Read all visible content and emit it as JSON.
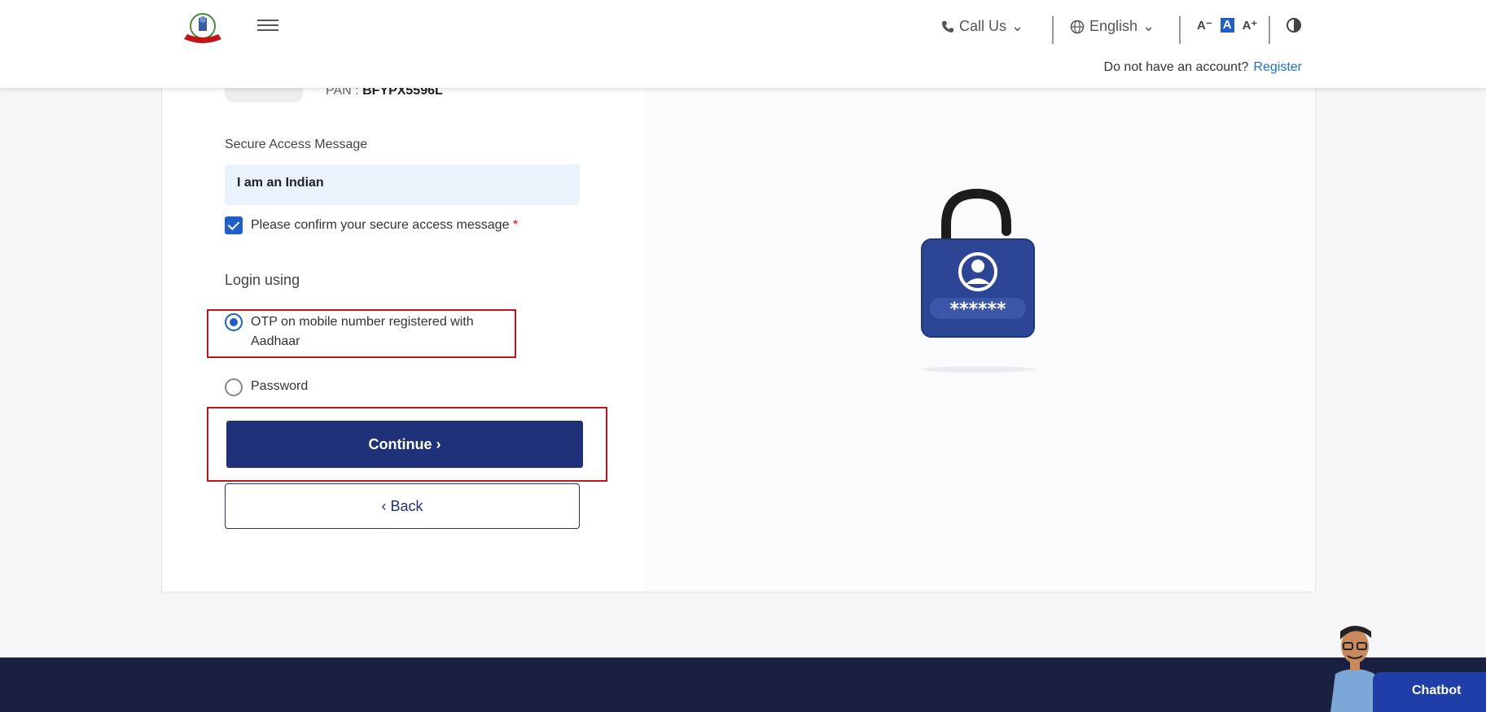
{
  "header": {
    "call_us": "Call Us",
    "language": "English",
    "font_controls": [
      "A⁻",
      "A",
      "A⁺"
    ],
    "account_prompt": "Do not have an account?",
    "register_link": "Register"
  },
  "profile": {
    "pan_label": "PAN :",
    "pan_value": "BFYPX5596L"
  },
  "secure_access": {
    "label": "Secure Access Message",
    "message": "I am an Indian",
    "confirm_text": "Please confirm your secure access message",
    "confirm_required_mark": "*",
    "confirmed": true
  },
  "login": {
    "heading": "Login using",
    "option_otp": "OTP on mobile number registered with Aadhaar",
    "option_password": "Password",
    "selected": "otp"
  },
  "buttons": {
    "continue_label": "Continue  ›",
    "back_label": "‹  Back"
  },
  "lock_graphic": {
    "mask_text": "******"
  },
  "chatbot": {
    "label": "Chatbot"
  },
  "colors": {
    "primary": "#1f3178",
    "accent": "#1f5fc9",
    "highlight": "#c3141c",
    "footer": "#1a2140"
  }
}
